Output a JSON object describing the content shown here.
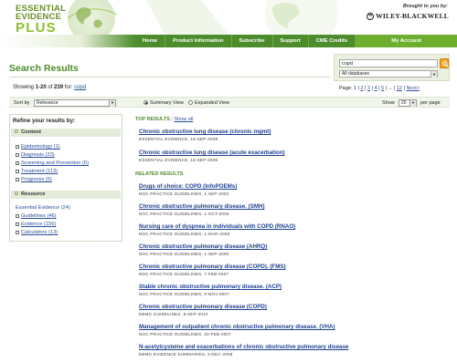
{
  "header": {
    "logo_line1": "ESSENTIAL",
    "logo_line2": "EVIDENCE",
    "logo_line3": "PLUS",
    "brought_by": "Brought to you by:",
    "publisher": "WILEY-BLACKWELL",
    "publisher_mark": "W"
  },
  "nav": {
    "items": [
      {
        "label": "Home"
      },
      {
        "label": "Product Information"
      },
      {
        "label": "Subscribe"
      },
      {
        "label": "Support"
      },
      {
        "label": "CME Credits"
      },
      {
        "label": "My Account"
      }
    ]
  },
  "page": {
    "title": "Search Results"
  },
  "search": {
    "query": "copd",
    "database": "All databases"
  },
  "summary": {
    "prefix": "Showing ",
    "range": "1-20",
    "middle": " of ",
    "total": "239",
    "for": " for: ",
    "query": "copd"
  },
  "pager": {
    "label": "Page:",
    "pages": [
      "1",
      "2",
      "3",
      "4",
      "5"
    ],
    "ellipsis": "...",
    "last": "12",
    "next": "Next>"
  },
  "sortbar": {
    "sort_label": "Sort by",
    "sort_value": "Relevance",
    "summary_view": "Summary View",
    "expanded_view": "Expanded View",
    "show_label": "Show",
    "show_value": "20",
    "per_page": "per page"
  },
  "sidebar": {
    "title": "Refine your results by:",
    "content_heading": "Content",
    "content_items": [
      {
        "label": "Epidemiology (1)"
      },
      {
        "label": "Diagnosis (23)"
      },
      {
        "label": "Screening and Prevention (5)"
      },
      {
        "label": "Treatment (113)"
      },
      {
        "label": "Prognosis (6)"
      }
    ],
    "resource_heading": "Resource",
    "resource_items": [
      {
        "label": "Essential Evidence (24)"
      },
      {
        "label": "Guidelines (46)"
      },
      {
        "label": "Evidence (156)"
      },
      {
        "label": "Calculators (13)"
      }
    ]
  },
  "results": {
    "top_label": "TOP RESULTS",
    "sep": " | ",
    "show_all": "Show all",
    "top": [
      {
        "title": "Chronic obstructive lung disease (chronic mgmt)",
        "source": "ESSENTIAL EVIDENCE, 16-SEP-2009"
      },
      {
        "title": "Chronic obstructive lung disease (acute exacerbation)",
        "source": "ESSENTIAL EVIDENCE, 19-SEP-2009"
      }
    ],
    "related_label": "RELATED RESULTS",
    "related": [
      {
        "title": "Drugs of choice: COPD (InfoPOEMs)",
        "source": "NGC PRACTICE GUIDELINES, 1-SEP-2003"
      },
      {
        "title": "Chronic obstructive pulmonary disease. (SMH)",
        "source": "NGC PRACTICE GUIDELINES, 1-OCT-2006"
      },
      {
        "title": "Nursing care of dyspnea in individuals with COPD (RNAO)",
        "source": "NGC PRACTICE GUIDELINES, 1-MAR-2005"
      },
      {
        "title": "Chronic obstructive pulmonary disease (AHRQ)",
        "source": "NGC PRACTICE GUIDELINES, 1-SEP-2000"
      },
      {
        "title": "Chronic obstructive pulmonary disease (COPD). (FMS)",
        "source": "NGC PRACTICE GUIDELINES, 7-FEB-2007"
      },
      {
        "title": "Stable chronic obstructive pulmonary disease. (ACP)",
        "source": "NGC PRACTICE GUIDELINES, 6-NOV-2007"
      },
      {
        "title": "Chronic obstructive pulmonary disease (COPD)",
        "source": "EBMG GUIDELINES, 8-SEP-2010"
      },
      {
        "title": "Management of outpatient chronic obstructive pulmonary disease. (VHA)",
        "source": "NGC PRACTICE GUIDELINES, 22-FEB-2007"
      },
      {
        "title": "N-acetylcysteine and exacerbations of chronic obstructive pulmonary disease",
        "source": "EBMG EVIDENCE SUMMARIES, 2-DEC-2008"
      }
    ]
  },
  "colors": {
    "brand_green": "#4c8c2b",
    "accent_green": "#6eae2f",
    "link_blue": "#1e3f8f",
    "search_button": "#f5a623"
  }
}
